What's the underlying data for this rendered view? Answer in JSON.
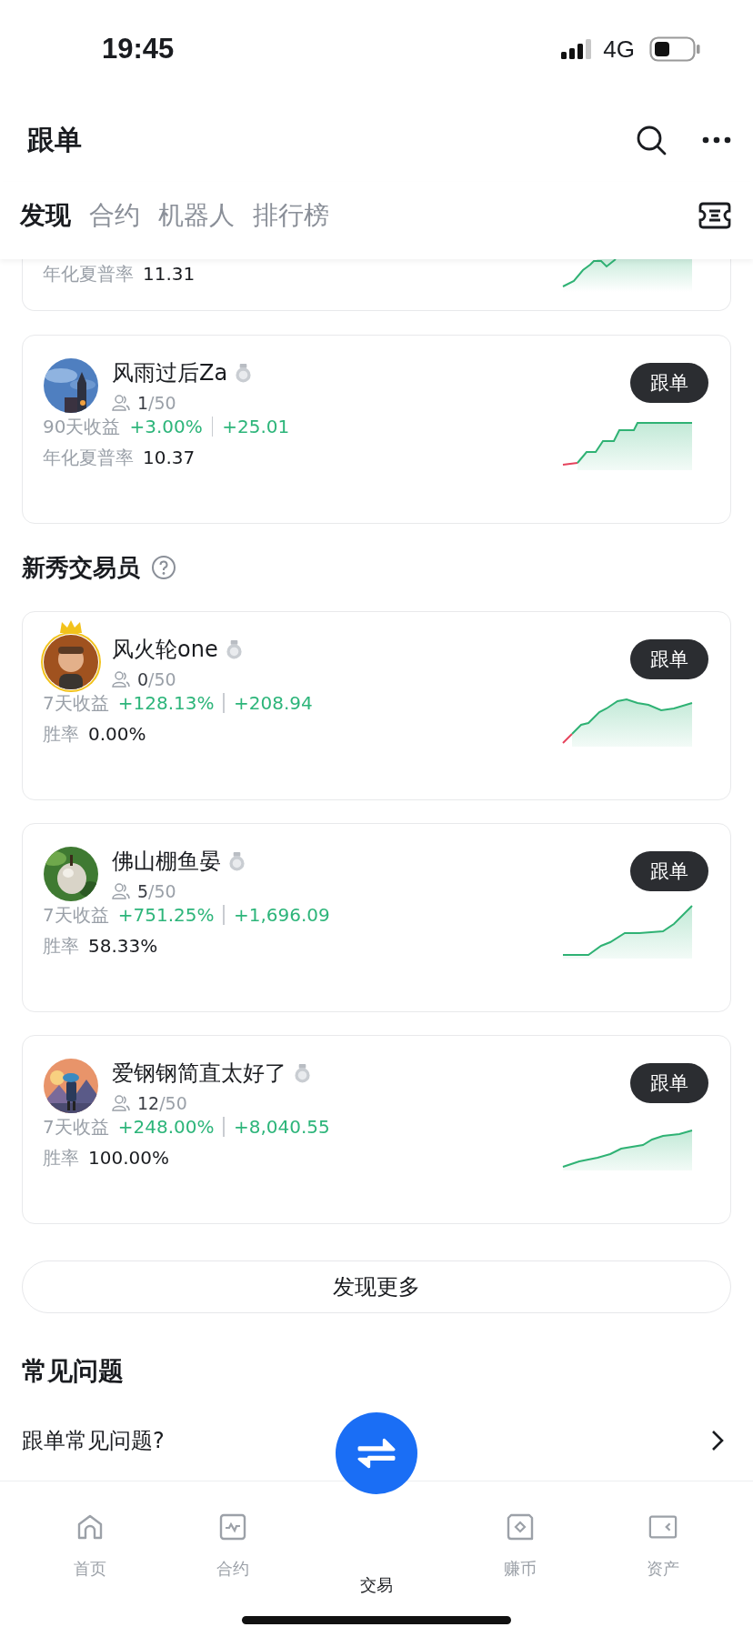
{
  "status_bar": {
    "time": "19:45",
    "network": "4G"
  },
  "header": {
    "title": "跟单"
  },
  "tabs": [
    {
      "label": "发现",
      "selected": true
    },
    {
      "label": "合约",
      "selected": false
    },
    {
      "label": "机器人",
      "selected": false
    },
    {
      "label": "排行榜",
      "selected": false
    }
  ],
  "partial_card": {
    "metric_label": "年化夏普率",
    "metric_value": "11.31"
  },
  "top_traders": [
    {
      "name": "风雨过后Za",
      "crown": false,
      "followers": "1",
      "capacity": "/50",
      "period_label": "90天收益",
      "return_pct": "+3.00%",
      "pnl": "+25.01",
      "metric_label": "年化夏普率",
      "metric_value": "10.37",
      "button": "跟单"
    }
  ],
  "rookie_section": {
    "title": "新秀交易员"
  },
  "rookie_traders": [
    {
      "name": "风火轮one",
      "crown": true,
      "followers": "0",
      "capacity": "/50",
      "period_label": "7天收益",
      "return_pct": "+128.13%",
      "pnl": "+208.94",
      "metric_label": "胜率",
      "metric_value": "0.00%",
      "button": "跟单"
    },
    {
      "name": "佛山棚鱼晏",
      "crown": false,
      "followers": "5",
      "capacity": "/50",
      "period_label": "7天收益",
      "return_pct": "+751.25%",
      "pnl": "+1,696.09",
      "metric_label": "胜率",
      "metric_value": "58.33%",
      "button": "跟单"
    },
    {
      "name": "爱钢钢简直太好了",
      "crown": false,
      "followers": "12",
      "capacity": "/50",
      "period_label": "7天收益",
      "return_pct": "+248.00%",
      "pnl": "+8,040.55",
      "metric_label": "胜率",
      "metric_value": "100.00%",
      "button": "跟单"
    }
  ],
  "more_button": "发现更多",
  "faq": {
    "title": "常见问题",
    "items": [
      {
        "label": "跟单常见问题?"
      }
    ]
  },
  "bottom_nav": [
    {
      "label": "首页",
      "kind": "home",
      "selected": false
    },
    {
      "label": "合约",
      "kind": "chart",
      "selected": false
    },
    {
      "label": "交易",
      "kind": "swap",
      "selected": true
    },
    {
      "label": "赚币",
      "kind": "coin",
      "selected": false
    },
    {
      "label": "资产",
      "kind": "wallet",
      "selected": false
    }
  ]
}
